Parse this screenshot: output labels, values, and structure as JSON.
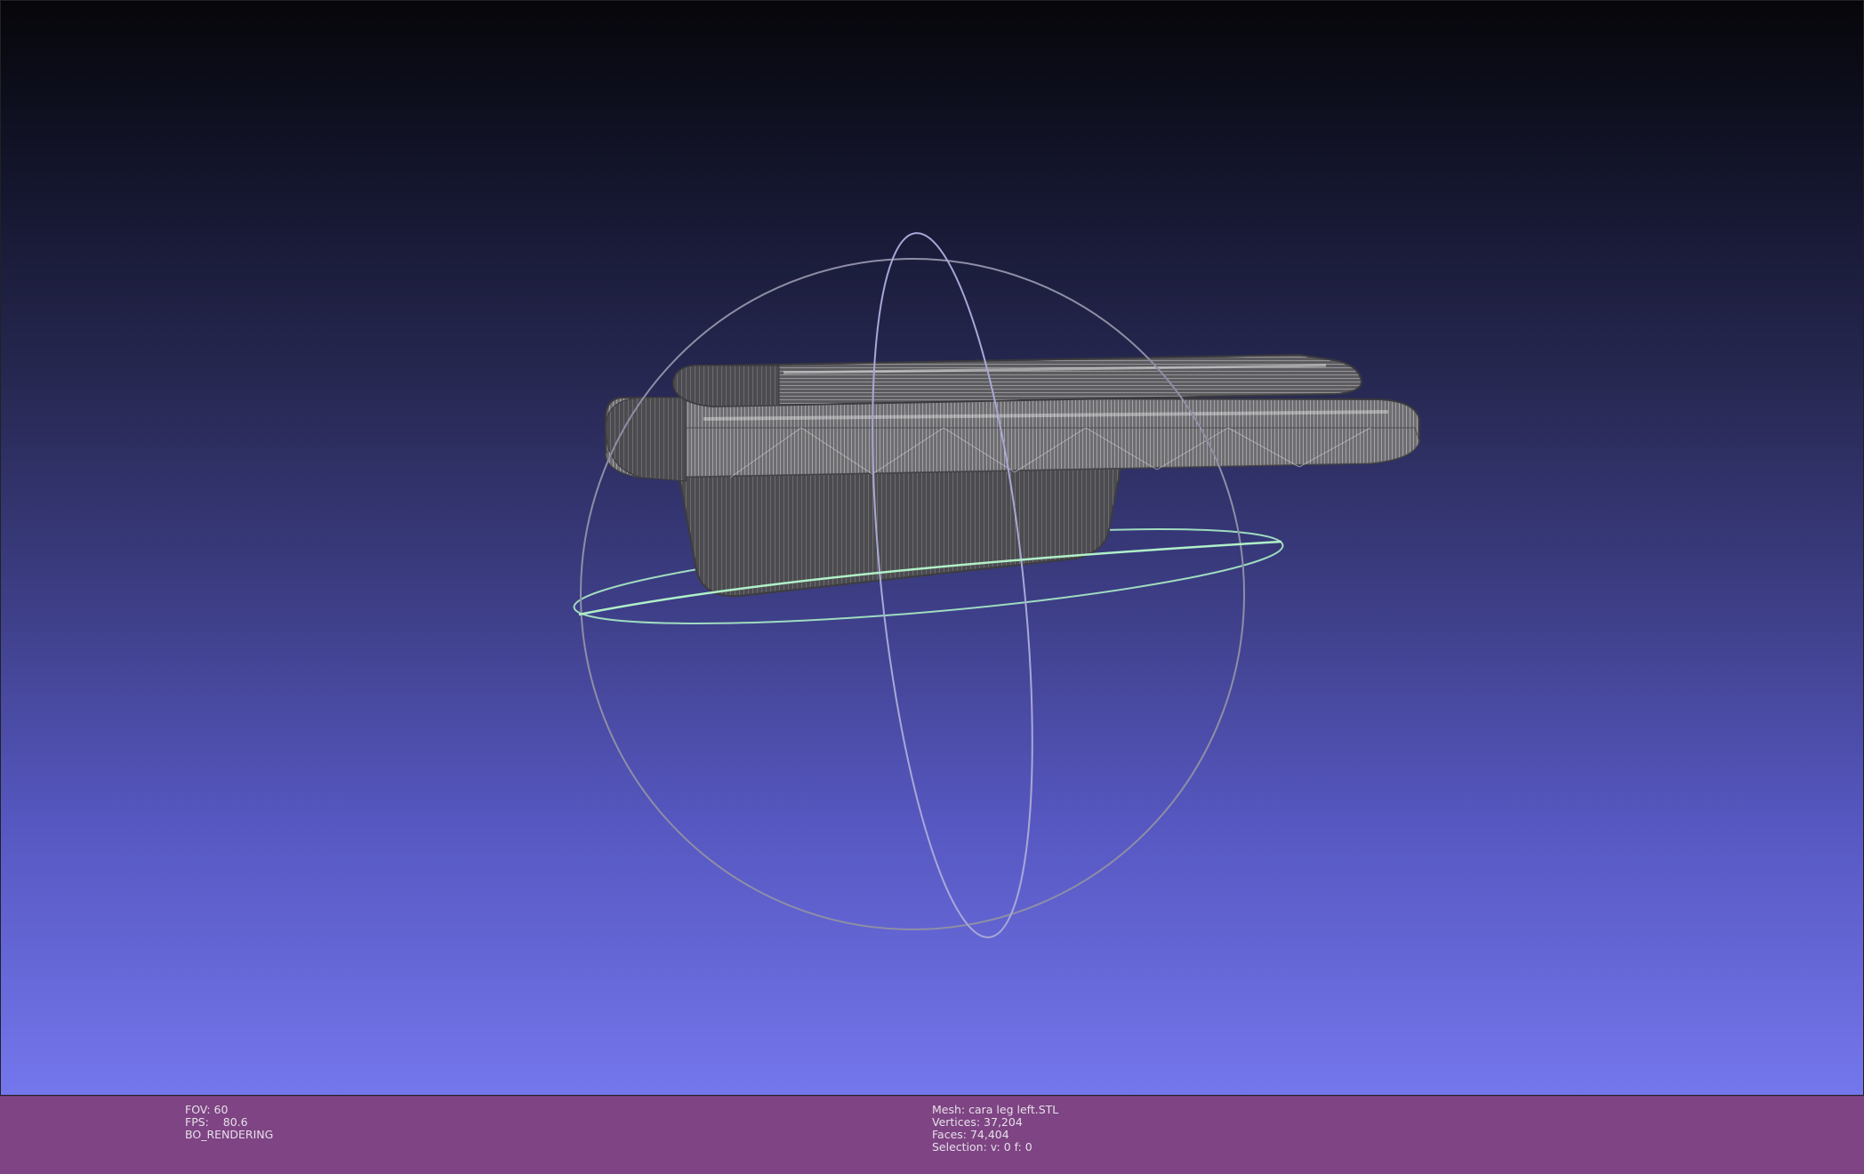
{
  "viewer": {
    "background_top": "#06060a",
    "background_bottom": "#7476ec",
    "mesh_color": "#5a5a5c",
    "trackball_color": "#8a8aa8",
    "trackball_accent": "#b0f0c8"
  },
  "info_left": {
    "fov": "FOV: 60",
    "fps": "FPS:    80.6",
    "mode": "BO_RENDERING"
  },
  "info_mid": {
    "mesh": "Mesh: cara leg left.STL",
    "vertices": "Vertices: 37,204",
    "faces": "Faces: 74,404",
    "selection": "Selection: v: 0 f: 0"
  },
  "infobar_color": "#7e4483"
}
